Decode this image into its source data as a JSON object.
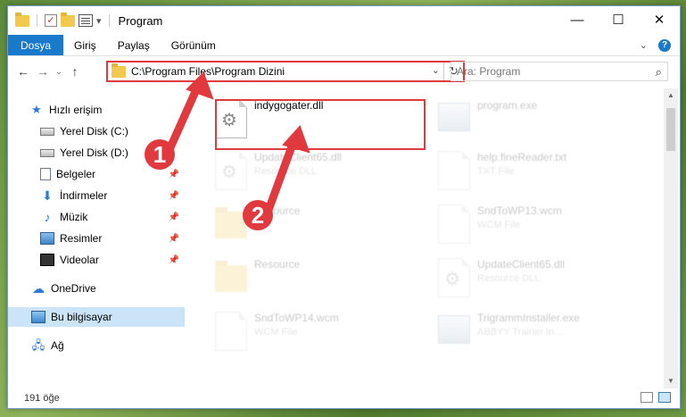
{
  "window": {
    "title": "Program"
  },
  "controls": {
    "minimize": "—",
    "maximize": "☐",
    "close": "✕"
  },
  "ribbon": {
    "tabs": [
      "Dosya",
      "Giriş",
      "Paylaş",
      "Görünüm"
    ],
    "collapse": "⌄",
    "help": "?"
  },
  "address": {
    "path": "C:\\Program Files\\Program Dizini",
    "dropdown": "⌄",
    "refresh": "↻"
  },
  "nav": {
    "back": "←",
    "forward": "→",
    "recent": "⌄",
    "up": "↑"
  },
  "search": {
    "placeholder": "Ara: Program",
    "icon": "⌕"
  },
  "sidebar": {
    "items": [
      {
        "label": "Hızlı erişim",
        "icon": "star-icon"
      },
      {
        "label": "Yerel Disk (C:)",
        "icon": "disk-icon",
        "pin": "📌"
      },
      {
        "label": "Yerel Disk (D:)",
        "icon": "disk-icon",
        "pin": "📌"
      },
      {
        "label": "Belgeler",
        "icon": "document-icon",
        "pin": "📌"
      },
      {
        "label": "İndirmeler",
        "icon": "download-icon",
        "pin": "📌"
      },
      {
        "label": "Müzik",
        "icon": "music-icon",
        "pin": "📌"
      },
      {
        "label": "Resimler",
        "icon": "pictures-icon",
        "pin": "📌"
      },
      {
        "label": "Videolar",
        "icon": "video-icon",
        "pin": "📌"
      },
      {
        "label": "OneDrive",
        "icon": "cloud-icon"
      },
      {
        "label": "Bu bilgisayar",
        "icon": "computer-icon"
      },
      {
        "label": "Ağ",
        "icon": "network-icon"
      }
    ]
  },
  "files": [
    {
      "name": "indygogater.dll",
      "type": "",
      "kind": "dll"
    },
    {
      "name": "program.exe",
      "type": "",
      "kind": "exe"
    },
    {
      "name": "UpdateClient65.dll",
      "type": "Resource DLL",
      "kind": "dll"
    },
    {
      "name": "help.fineReader.txt",
      "type": "TXT File",
      "kind": "doc"
    },
    {
      "name": "Resource",
      "type": "",
      "kind": "folder"
    },
    {
      "name": "SndToWP13.wcm",
      "type": "WCM File",
      "kind": "doc"
    },
    {
      "name": "Resource",
      "type": "",
      "kind": "folder"
    },
    {
      "name": "UpdateClient65.dll",
      "type": "Resource DLL",
      "kind": "dll"
    },
    {
      "name": "SndToWP14.wcm",
      "type": "WCM File",
      "kind": "doc"
    },
    {
      "name": "TrigrammInstaller.exe",
      "type": "ABBYY Trainer In...",
      "kind": "exe"
    }
  ],
  "status": {
    "count": "191 öğe"
  },
  "annotations": {
    "step1": "1",
    "step2": "2",
    "accent": "#e0393e"
  }
}
